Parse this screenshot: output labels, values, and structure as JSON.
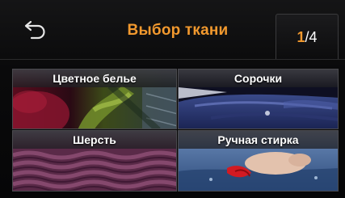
{
  "header": {
    "title": "Выбор ткани",
    "page_current": "1",
    "page_total": "/4"
  },
  "tiles": [
    {
      "label": "Цветное белье",
      "image": "colored-laundry"
    },
    {
      "label": "Сорочки",
      "image": "shirts"
    },
    {
      "label": "Шерсть",
      "image": "wool"
    },
    {
      "label": "Ручная стирка",
      "image": "hand-wash"
    }
  ],
  "colors": {
    "accent": "#f2992e",
    "background": "#0b0b0c",
    "text": "#ffffff"
  }
}
